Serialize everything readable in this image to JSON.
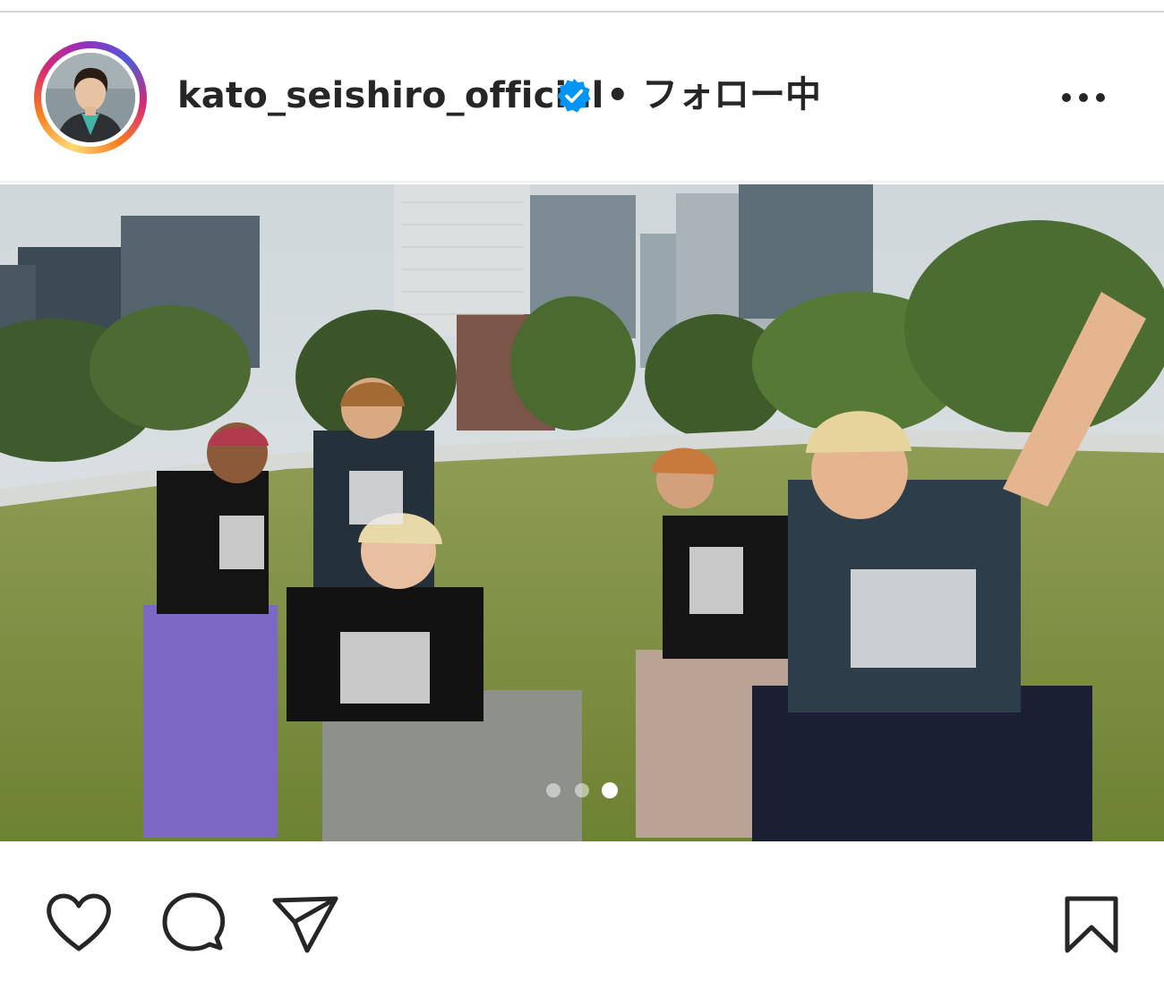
{
  "post": {
    "username": "kato_seishiro_official",
    "separator": "•",
    "follow_status": "フォロー中",
    "carousel": {
      "total": 3,
      "active_index": 2
    }
  },
  "icons": {
    "avatar": "profile-avatar",
    "verified": "verified-badge-icon",
    "more": "more-options-icon",
    "like": "heart-icon",
    "comment": "comment-icon",
    "share": "send-icon",
    "save": "bookmark-icon"
  },
  "colors": {
    "text": "#262626",
    "verified": "#0095f6",
    "carousel_dot_active": "#ffffff",
    "carousel_dot_inactive": "#ffffff80"
  }
}
